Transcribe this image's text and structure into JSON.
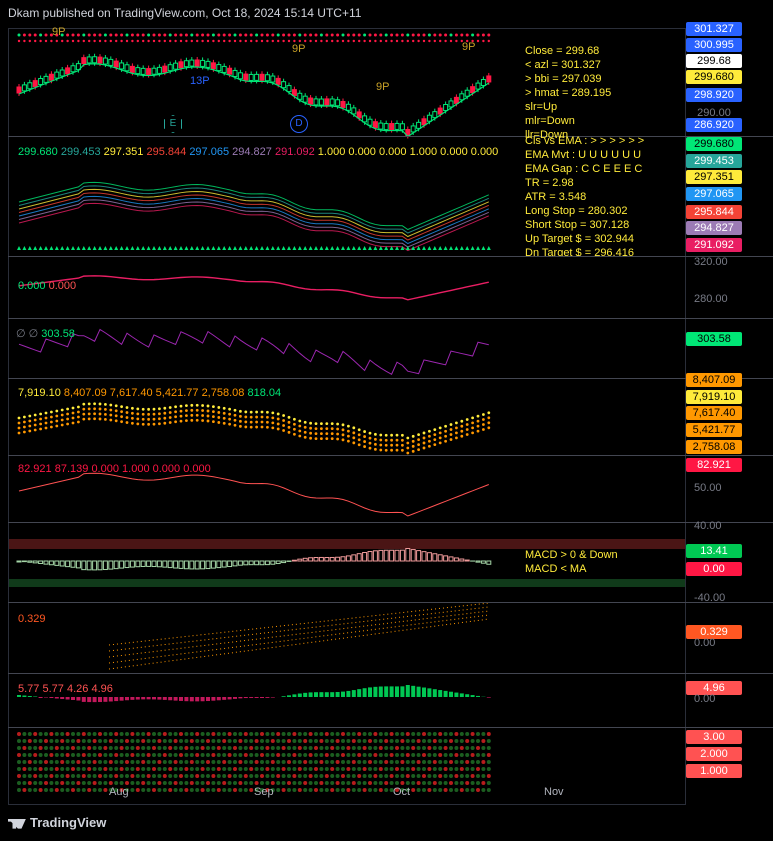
{
  "header": {
    "publisher": "Dkam published on TradingView.com, Oct 18, 2024 15:14 UTC+11"
  },
  "footer": {
    "brand": "TradingView"
  },
  "colors": {
    "green": "#00e676",
    "red": "#ff1744",
    "yellow": "#ffeb3b",
    "blue": "#2962ff",
    "white": "#ffffff"
  },
  "x_axis": {
    "labels": [
      "Aug",
      "Sep",
      "Oct",
      "Nov"
    ]
  },
  "main": {
    "markers": [
      "9P",
      "9P",
      "13P",
      "9P",
      "9P"
    ],
    "badges": [
      "E",
      "D"
    ],
    "info": [
      "Close = 299.68",
      "< azl = 301.327",
      "> bbi = 297.039",
      "> hmat = 289.195",
      "slr=Up",
      "mlr=Down",
      "llr=Down"
    ],
    "tags": [
      {
        "text": "301.327",
        "bg": "#2962ff",
        "fg": "#fff"
      },
      {
        "text": "300.995",
        "bg": "#2962ff",
        "fg": "#fff"
      },
      {
        "text": "299.68",
        "bg": "#ffffff",
        "fg": "#000"
      },
      {
        "text": "299.680",
        "bg": "#ffeb3b",
        "fg": "#000"
      },
      {
        "text": "298.920",
        "bg": "#2962ff",
        "fg": "#fff"
      },
      {
        "text": "290.00",
        "bg": "",
        "fg": "#787b86"
      },
      {
        "text": "286.920",
        "bg": "#2962ff",
        "fg": "#fff"
      }
    ]
  },
  "pane2": {
    "legend": [
      "299.680",
      "299.453",
      "297.351",
      "295.844",
      "297.065",
      "294.827",
      "291.092",
      "1.000",
      "0.000",
      "0.000",
      "1.000",
      "0.000",
      "0.000"
    ],
    "info": [
      "Cls vs EMA : > > > > > >",
      "EMA Mvt : U U U U U U",
      "EMA Gap : C C E E E C",
      "TR = 2.98",
      "ATR = 3.548",
      "Long Stop = 280.302",
      "Short Stop = 307.128",
      "Up Target $ = 302.944",
      "Dn Target $ = 296.416"
    ],
    "tags": [
      {
        "text": "299.680",
        "bg": "#00e676",
        "fg": "#000"
      },
      {
        "text": "299.453",
        "bg": "#26a69a",
        "fg": "#fff"
      },
      {
        "text": "297.351",
        "bg": "#ffeb3b",
        "fg": "#000"
      },
      {
        "text": "297.065",
        "bg": "#2196f3",
        "fg": "#fff"
      },
      {
        "text": "295.844",
        "bg": "#f44336",
        "fg": "#fff"
      },
      {
        "text": "294.827",
        "bg": "#9c7bb5",
        "fg": "#fff"
      },
      {
        "text": "291.092",
        "bg": "#e91e63",
        "fg": "#fff"
      }
    ]
  },
  "pane3": {
    "legend": [
      "0.000",
      "0.000"
    ],
    "axis": [
      "320.00",
      "280.00"
    ]
  },
  "pane4": {
    "legend": [
      "303.58"
    ],
    "tag": "303.58"
  },
  "pane5": {
    "legend": [
      "7,919.10",
      "8,407.09",
      "7,617.40",
      "5,421.77",
      "2,758.08",
      "818.04"
    ],
    "tags": [
      {
        "text": "8,407.09",
        "bg": "#ff9800",
        "fg": "#000"
      },
      {
        "text": "7,919.10",
        "bg": "#ffeb3b",
        "fg": "#000"
      },
      {
        "text": "7,617.40",
        "bg": "#ff9800",
        "fg": "#000"
      },
      {
        "text": "5,421.77",
        "bg": "#ff9800",
        "fg": "#000"
      },
      {
        "text": "2,758.08",
        "bg": "#ff9800",
        "fg": "#000"
      }
    ]
  },
  "pane6": {
    "legend": [
      "82.921",
      "87.139",
      "0.000",
      "1.000",
      "0.000",
      "0.000"
    ],
    "tag": "82.921",
    "axis": [
      "50.00"
    ]
  },
  "pane7": {
    "axis": [
      "40.00",
      "-40.00"
    ],
    "info": [
      "MACD > 0 & Down",
      "MACD < MA"
    ],
    "tags": [
      {
        "text": "13.41",
        "bg": "#00c853",
        "fg": "#fff"
      },
      {
        "text": "0.00",
        "bg": "#ff1744",
        "fg": "#fff"
      }
    ]
  },
  "pane8": {
    "legend": [
      "0.329"
    ],
    "tag": "0.329",
    "axis": [
      "0.00"
    ]
  },
  "pane9": {
    "legend": [
      "5.77",
      "5.77",
      "4.26",
      "4.96"
    ],
    "tag": "4.96",
    "axis": [
      "0.00"
    ]
  },
  "pane10": {
    "tags": [
      "3.00",
      "2.000",
      "1.000"
    ]
  }
}
